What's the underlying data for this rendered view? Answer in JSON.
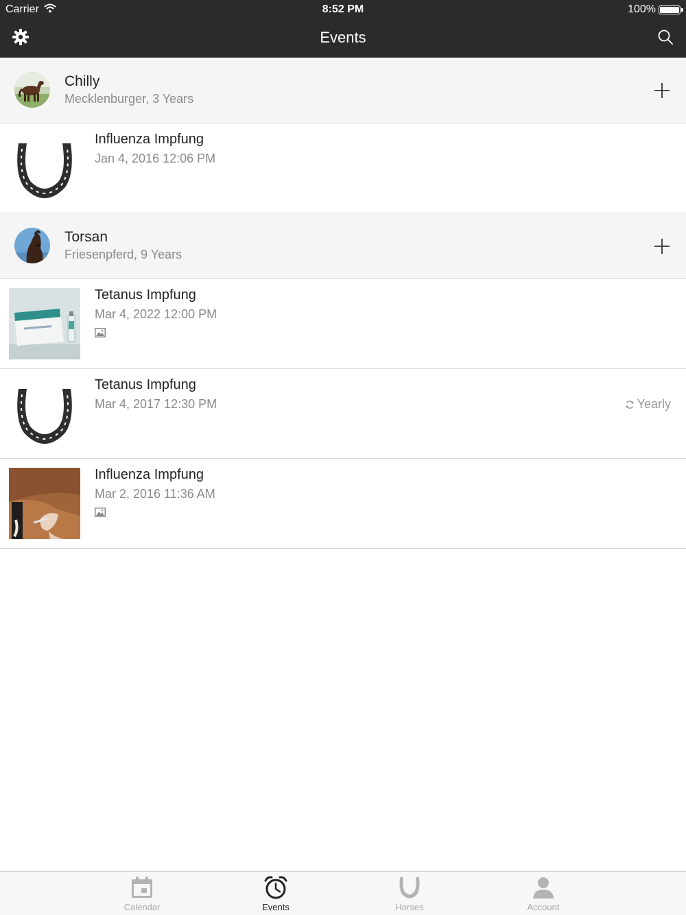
{
  "status_bar": {
    "carrier": "Carrier",
    "time": "8:52 PM",
    "battery": "100%"
  },
  "nav": {
    "title": "Events",
    "left_icon": "gear-icon",
    "right_icon": "search-icon"
  },
  "sections": [
    {
      "horse_name": "Chilly",
      "horse_details": "Mecklenburger, 3 Years",
      "events": [
        {
          "title": "Influenza Impfung",
          "date": "Jan 4, 2016 12:06 PM",
          "thumbnail": "horseshoe",
          "has_image": false,
          "repeat": ""
        }
      ]
    },
    {
      "horse_name": "Torsan",
      "horse_details": "Friesenpferd, 9 Years",
      "events": [
        {
          "title": "Tetanus Impfung",
          "date": "Mar 4, 2022 12:00 PM",
          "thumbnail": "vaccine-box-photo",
          "has_image": true,
          "repeat": ""
        },
        {
          "title": "Tetanus Impfung",
          "date": "Mar 4, 2017 12:30 PM",
          "thumbnail": "horseshoe",
          "has_image": false,
          "repeat": "Yearly"
        },
        {
          "title": "Influenza Impfung",
          "date": "Mar 2, 2016 11:36 AM",
          "thumbnail": "injection-photo",
          "has_image": true,
          "repeat": ""
        }
      ]
    }
  ],
  "tabbar": {
    "tabs": [
      {
        "label": "Calendar",
        "icon": "calendar-icon",
        "active": false
      },
      {
        "label": "Events",
        "icon": "alarm-clock-icon",
        "active": true
      },
      {
        "label": "Horses",
        "icon": "horseshoe-icon",
        "active": false
      },
      {
        "label": "Account",
        "icon": "person-icon",
        "active": false
      }
    ]
  },
  "colors": {
    "nav_background": "#2b2b2b",
    "section_background": "#f5f5f5",
    "secondary_text": "#8a8a8a",
    "tab_inactive": "#a8a8a8",
    "tab_active": "#222222"
  }
}
